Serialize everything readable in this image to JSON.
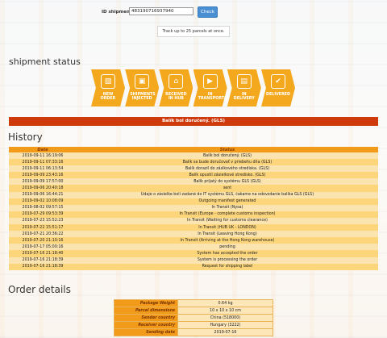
{
  "search": {
    "label": "ID shipment",
    "value": "483190716937940",
    "button": "Check",
    "hint": "Track up to 25 parcels at once."
  },
  "status_heading": "shipment status",
  "steps": [
    {
      "label": "NEW ORDER",
      "icon": "new-order-icon"
    },
    {
      "label": "SHIPMENTS INJECTED",
      "icon": "package-hand-icon"
    },
    {
      "label": "RECEIVED IN HUB",
      "icon": "warehouse-icon"
    },
    {
      "label": "IN TRANSPORTATION",
      "icon": "truck-icon"
    },
    {
      "label": "IN DELIVERY",
      "icon": "delivery-icon"
    },
    {
      "label": "DELIVERED",
      "icon": "delivered-icon"
    }
  ],
  "current_status": "Balík bol doručený. (GLS)",
  "history_heading": "History",
  "history_columns": [
    "Date",
    "Status"
  ],
  "history": [
    [
      "2019-09-11 16:19:06",
      "Balík bol doručený. (GLS)"
    ],
    [
      "2019-09-11 07:33:16",
      "Balík sa bude doručovať v priebehu dňa (GLS)"
    ],
    [
      "2019-09-11 06:13:54",
      "Balík dorazil do záslkového strediska. (GLS)"
    ],
    [
      "2019-09-09 23:43:16",
      "Balík opustil zásielkové stredisko. (GLS)"
    ],
    [
      "2019-09-09 17:57:00",
      "Balík prijatý do systému GLS (GLS)"
    ],
    [
      "2019-09-06 20:40:18",
      "sent"
    ],
    [
      "2019-09-06 16:44:21",
      "Údaje o zásielke boli zadané do IT systému GLS, čakame na odovzdanie balíka GLS (GLS)"
    ],
    [
      "2019-09-02 10:08:09",
      "Outgoing manifest generated"
    ],
    [
      "2019-08-02 09:57:15",
      "In Transit (Nysa)"
    ],
    [
      "2019-07-29 09:53:39",
      "In Transit (Europe - complete customs inspection)"
    ],
    [
      "2019-07-23 15:52:23",
      "In Transit (Waiting for customs clearance)"
    ],
    [
      "2019-07-22 15:51:17",
      "In Transit (HUB UK - LONDON)"
    ],
    [
      "2019-07-21 20:36:22",
      "In Transit (Leaving Hong Kong)"
    ],
    [
      "2019-07-20 21:10:16",
      "In Transit (Arriving at the Hong Kong warehouse)"
    ],
    [
      "2019-07-17 05:00:16",
      "pending"
    ],
    [
      "2019-07-16 21:18:40",
      "System has accepted the order"
    ],
    [
      "2019-07-16 21:18:39",
      "System is processing the order"
    ],
    [
      "2019-07-16 21:18:39",
      "Request for shipping label"
    ]
  ],
  "order_heading": "Order details",
  "order": [
    [
      "Package Weight",
      "0.64 kg"
    ],
    [
      "Parcel dimensions",
      "10 x 10 x 10 cm"
    ],
    [
      "Sender country",
      "China (518000)"
    ],
    [
      "Receiver country",
      "Hungary (3222)"
    ],
    [
      "Sending date",
      "2019-07-16"
    ]
  ],
  "colors": {
    "accent": "#f4a81e",
    "status_bar": "#cf3a0d",
    "button": "#4a8fd2"
  }
}
